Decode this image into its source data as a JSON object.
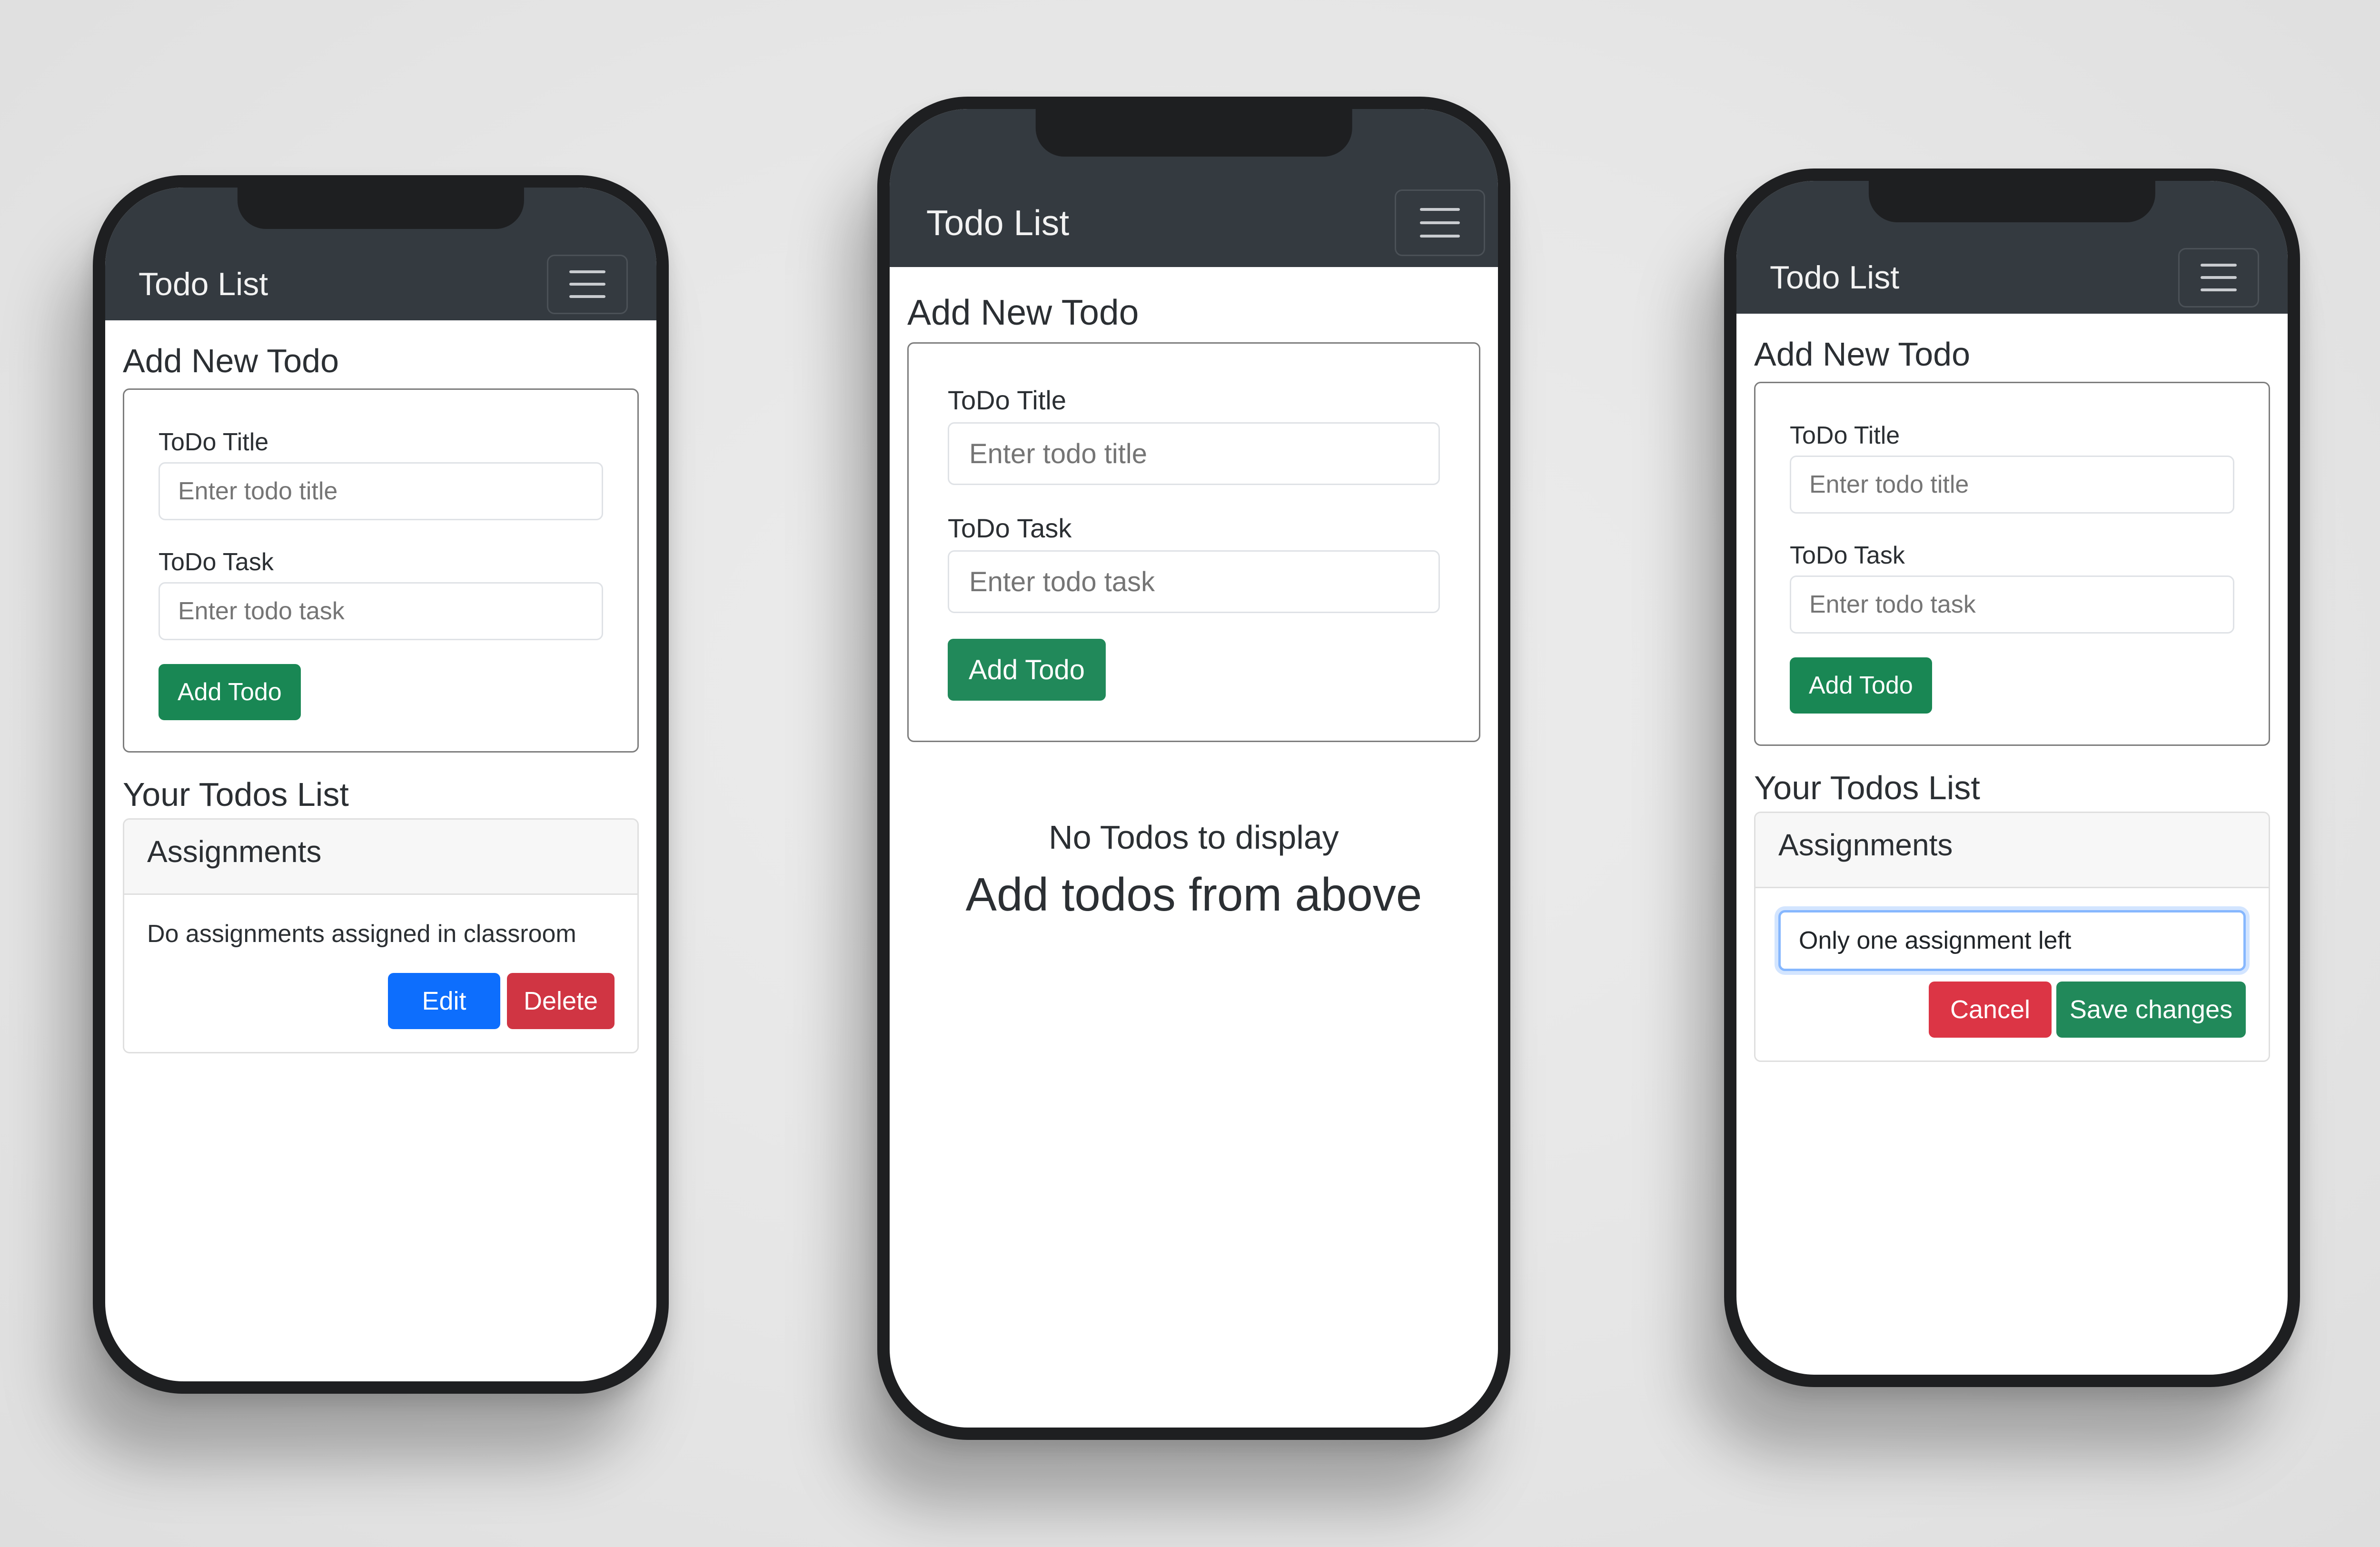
{
  "app": {
    "brand": "Todo List",
    "menu_icon": "hamburger-icon"
  },
  "form": {
    "section_title": "Add New Todo",
    "title_label": "ToDo Title",
    "title_placeholder": "Enter todo title",
    "task_label": "ToDo Task",
    "task_placeholder": "Enter todo task",
    "submit_label": "Add Todo"
  },
  "list": {
    "section_title": "Your Todos List",
    "empty_line1": "No Todos to display",
    "empty_line2": "Add todos from above"
  },
  "phone_left": {
    "todo": {
      "title": "Assignments",
      "task": "Do assignments assigned in classroom",
      "edit_label": "Edit",
      "delete_label": "Delete"
    }
  },
  "phone_right": {
    "todo": {
      "title": "Assignments",
      "edit_value": "Only one assignment left",
      "cancel_label": "Cancel",
      "save_label": "Save changes"
    }
  },
  "colors": {
    "navbar": "#343a40",
    "success": "#198754",
    "primary": "#0d6efd",
    "danger": "#dc3545",
    "focus_ring": "#86b7fe"
  }
}
